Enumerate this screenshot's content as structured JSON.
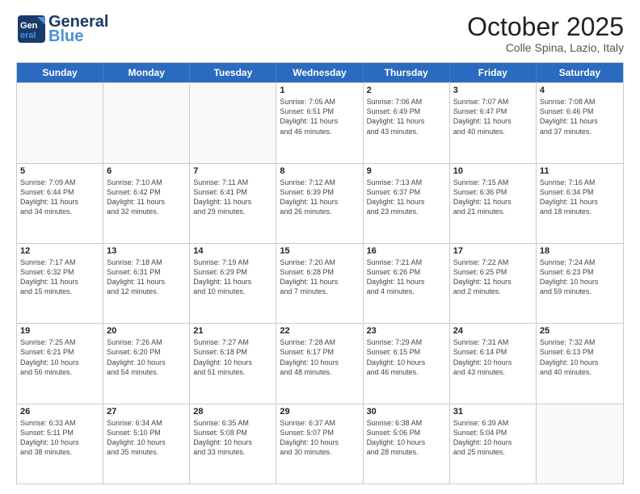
{
  "header": {
    "logo_general": "General",
    "logo_blue": "Blue",
    "title": "October 2025",
    "subtitle": "Colle Spina, Lazio, Italy"
  },
  "days_of_week": [
    "Sunday",
    "Monday",
    "Tuesday",
    "Wednesday",
    "Thursday",
    "Friday",
    "Saturday"
  ],
  "weeks": [
    [
      {
        "day": "",
        "info": ""
      },
      {
        "day": "",
        "info": ""
      },
      {
        "day": "",
        "info": ""
      },
      {
        "day": "1",
        "info": "Sunrise: 7:05 AM\nSunset: 6:51 PM\nDaylight: 11 hours\nand 46 minutes."
      },
      {
        "day": "2",
        "info": "Sunrise: 7:06 AM\nSunset: 6:49 PM\nDaylight: 11 hours\nand 43 minutes."
      },
      {
        "day": "3",
        "info": "Sunrise: 7:07 AM\nSunset: 6:47 PM\nDaylight: 11 hours\nand 40 minutes."
      },
      {
        "day": "4",
        "info": "Sunrise: 7:08 AM\nSunset: 6:46 PM\nDaylight: 11 hours\nand 37 minutes."
      }
    ],
    [
      {
        "day": "5",
        "info": "Sunrise: 7:09 AM\nSunset: 6:44 PM\nDaylight: 11 hours\nand 34 minutes."
      },
      {
        "day": "6",
        "info": "Sunrise: 7:10 AM\nSunset: 6:42 PM\nDaylight: 11 hours\nand 32 minutes."
      },
      {
        "day": "7",
        "info": "Sunrise: 7:11 AM\nSunset: 6:41 PM\nDaylight: 11 hours\nand 29 minutes."
      },
      {
        "day": "8",
        "info": "Sunrise: 7:12 AM\nSunset: 6:39 PM\nDaylight: 11 hours\nand 26 minutes."
      },
      {
        "day": "9",
        "info": "Sunrise: 7:13 AM\nSunset: 6:37 PM\nDaylight: 11 hours\nand 23 minutes."
      },
      {
        "day": "10",
        "info": "Sunrise: 7:15 AM\nSunset: 6:36 PM\nDaylight: 11 hours\nand 21 minutes."
      },
      {
        "day": "11",
        "info": "Sunrise: 7:16 AM\nSunset: 6:34 PM\nDaylight: 11 hours\nand 18 minutes."
      }
    ],
    [
      {
        "day": "12",
        "info": "Sunrise: 7:17 AM\nSunset: 6:32 PM\nDaylight: 11 hours\nand 15 minutes."
      },
      {
        "day": "13",
        "info": "Sunrise: 7:18 AM\nSunset: 6:31 PM\nDaylight: 11 hours\nand 12 minutes."
      },
      {
        "day": "14",
        "info": "Sunrise: 7:19 AM\nSunset: 6:29 PM\nDaylight: 11 hours\nand 10 minutes."
      },
      {
        "day": "15",
        "info": "Sunrise: 7:20 AM\nSunset: 6:28 PM\nDaylight: 11 hours\nand 7 minutes."
      },
      {
        "day": "16",
        "info": "Sunrise: 7:21 AM\nSunset: 6:26 PM\nDaylight: 11 hours\nand 4 minutes."
      },
      {
        "day": "17",
        "info": "Sunrise: 7:22 AM\nSunset: 6:25 PM\nDaylight: 11 hours\nand 2 minutes."
      },
      {
        "day": "18",
        "info": "Sunrise: 7:24 AM\nSunset: 6:23 PM\nDaylight: 10 hours\nand 59 minutes."
      }
    ],
    [
      {
        "day": "19",
        "info": "Sunrise: 7:25 AM\nSunset: 6:21 PM\nDaylight: 10 hours\nand 56 minutes."
      },
      {
        "day": "20",
        "info": "Sunrise: 7:26 AM\nSunset: 6:20 PM\nDaylight: 10 hours\nand 54 minutes."
      },
      {
        "day": "21",
        "info": "Sunrise: 7:27 AM\nSunset: 6:18 PM\nDaylight: 10 hours\nand 51 minutes."
      },
      {
        "day": "22",
        "info": "Sunrise: 7:28 AM\nSunset: 6:17 PM\nDaylight: 10 hours\nand 48 minutes."
      },
      {
        "day": "23",
        "info": "Sunrise: 7:29 AM\nSunset: 6:15 PM\nDaylight: 10 hours\nand 46 minutes."
      },
      {
        "day": "24",
        "info": "Sunrise: 7:31 AM\nSunset: 6:14 PM\nDaylight: 10 hours\nand 43 minutes."
      },
      {
        "day": "25",
        "info": "Sunrise: 7:32 AM\nSunset: 6:13 PM\nDaylight: 10 hours\nand 40 minutes."
      }
    ],
    [
      {
        "day": "26",
        "info": "Sunrise: 6:33 AM\nSunset: 5:11 PM\nDaylight: 10 hours\nand 38 minutes."
      },
      {
        "day": "27",
        "info": "Sunrise: 6:34 AM\nSunset: 5:10 PM\nDaylight: 10 hours\nand 35 minutes."
      },
      {
        "day": "28",
        "info": "Sunrise: 6:35 AM\nSunset: 5:08 PM\nDaylight: 10 hours\nand 33 minutes."
      },
      {
        "day": "29",
        "info": "Sunrise: 6:37 AM\nSunset: 5:07 PM\nDaylight: 10 hours\nand 30 minutes."
      },
      {
        "day": "30",
        "info": "Sunrise: 6:38 AM\nSunset: 5:06 PM\nDaylight: 10 hours\nand 28 minutes."
      },
      {
        "day": "31",
        "info": "Sunrise: 6:39 AM\nSunset: 5:04 PM\nDaylight: 10 hours\nand 25 minutes."
      },
      {
        "day": "",
        "info": ""
      }
    ]
  ]
}
